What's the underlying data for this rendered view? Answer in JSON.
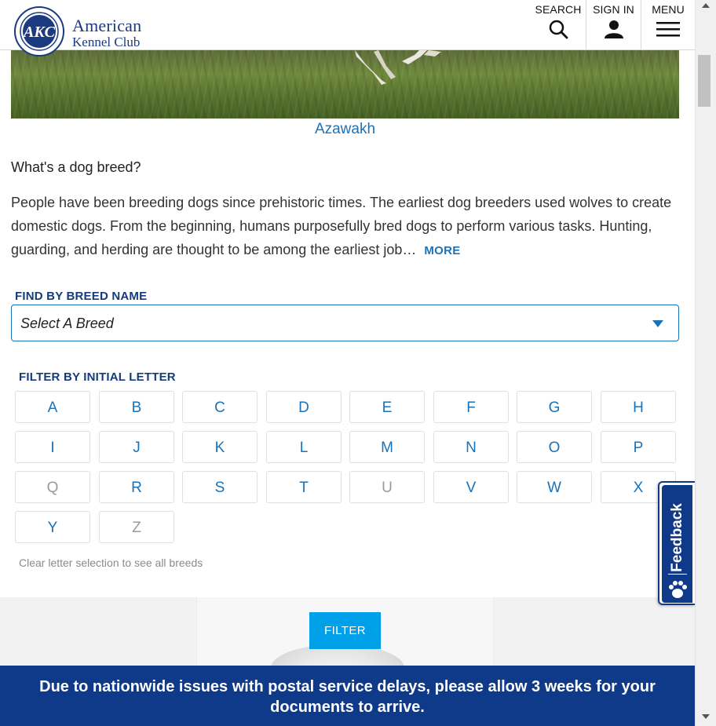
{
  "header": {
    "logo_ring_text": "AKC",
    "logo_line1": "American",
    "logo_line2": "Kennel Club",
    "search_label": "SEARCH",
    "signin_label": "SIGN IN",
    "menu_label": "MENU"
  },
  "hero": {
    "caption": "Azawakh"
  },
  "intro": {
    "question": "What's a dog breed?",
    "paragraph": "People have been breeding dogs since prehistoric times. The earliest dog breeders used wolves to create domestic dogs. From the beginning, humans purposefully bred dogs to perform various tasks. Hunting, guarding, and herding are thought to be among the earliest job…",
    "more_label": "MORE"
  },
  "find": {
    "label": "FIND BY BREED NAME",
    "select_value": "Select A Breed"
  },
  "filter": {
    "label": "FILTER BY INITIAL LETTER",
    "letters": [
      {
        "char": "A",
        "enabled": true
      },
      {
        "char": "B",
        "enabled": true
      },
      {
        "char": "C",
        "enabled": true
      },
      {
        "char": "D",
        "enabled": true
      },
      {
        "char": "E",
        "enabled": true
      },
      {
        "char": "F",
        "enabled": true
      },
      {
        "char": "G",
        "enabled": true
      },
      {
        "char": "H",
        "enabled": true
      },
      {
        "char": "I",
        "enabled": true
      },
      {
        "char": "J",
        "enabled": true
      },
      {
        "char": "K",
        "enabled": true
      },
      {
        "char": "L",
        "enabled": true
      },
      {
        "char": "M",
        "enabled": true
      },
      {
        "char": "N",
        "enabled": true
      },
      {
        "char": "O",
        "enabled": true
      },
      {
        "char": "P",
        "enabled": true
      },
      {
        "char": "Q",
        "enabled": false
      },
      {
        "char": "R",
        "enabled": true
      },
      {
        "char": "S",
        "enabled": true
      },
      {
        "char": "T",
        "enabled": true
      },
      {
        "char": "U",
        "enabled": false
      },
      {
        "char": "V",
        "enabled": true
      },
      {
        "char": "W",
        "enabled": true
      },
      {
        "char": "X",
        "enabled": true
      },
      {
        "char": "Y",
        "enabled": true
      },
      {
        "char": "Z",
        "enabled": false
      }
    ],
    "clear_text": "Clear letter selection to see all breeds",
    "button_label": "FILTER"
  },
  "banner": {
    "text": "Due to nationwide issues with postal service delays, please allow 3 weeks for your documents to arrive."
  },
  "feedback": {
    "label": "Feedback"
  },
  "colors": {
    "brand_navy": "#0f3a8a",
    "link_blue": "#1a72b8",
    "filter_button": "#00a0e9"
  }
}
